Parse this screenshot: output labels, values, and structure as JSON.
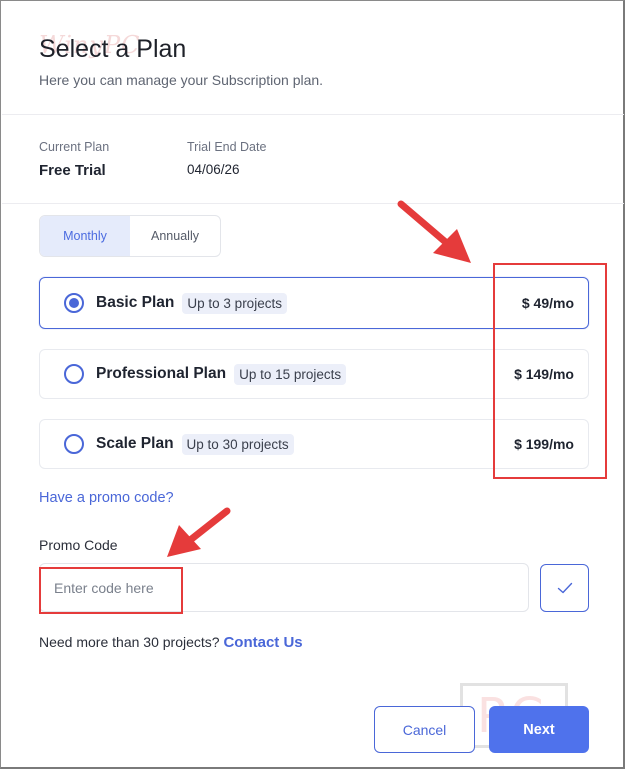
{
  "header": {
    "title": "Select a Plan",
    "subtitle": "Here you can manage your Subscription plan."
  },
  "current": {
    "plan_label": "Current Plan",
    "plan_value": "Free Trial",
    "trial_label": "Trial End Date",
    "trial_value": "04/06/26"
  },
  "billing": {
    "options": [
      "Monthly",
      "Annually"
    ],
    "selected": "Monthly"
  },
  "plans": [
    {
      "name": "Basic Plan",
      "badge": "Up to 3 projects",
      "price": "$ 49/mo",
      "selected": true
    },
    {
      "name": "Professional Plan",
      "badge": "Up to 15 projects",
      "price": "$ 149/mo",
      "selected": false
    },
    {
      "name": "Scale Plan",
      "badge": "Up to 30 projects",
      "price": "$ 199/mo",
      "selected": false
    }
  ],
  "promo": {
    "link": "Have a promo code?",
    "label": "Promo Code",
    "placeholder": "Enter code here",
    "value": ""
  },
  "footer": {
    "need_more": "Need more than 30 projects?",
    "contact": "Contact Us",
    "cancel": "Cancel",
    "next": "Next"
  },
  "colors": {
    "accent": "#4a67d8",
    "primary_button": "#4f72ec",
    "annotation": "#e53b3b"
  }
}
